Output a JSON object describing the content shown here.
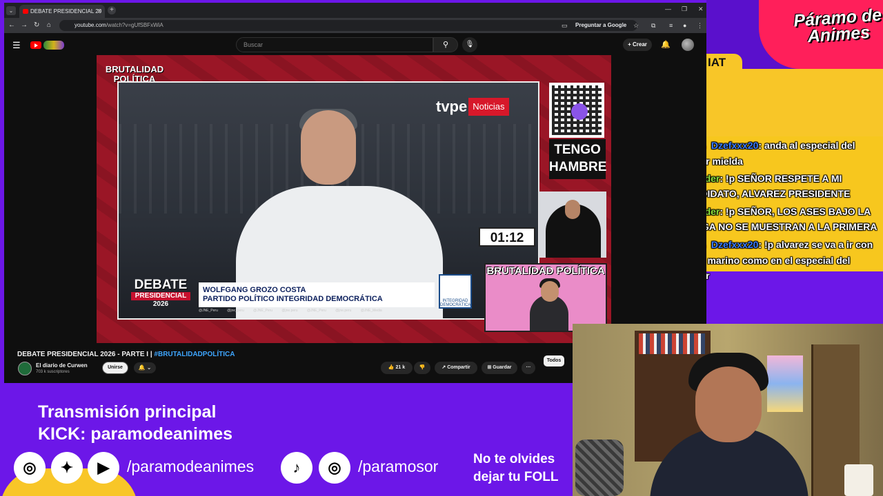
{
  "browser": {
    "tab_title": "DEBATE PRESIDENCIAL 20",
    "url_host": "youtube.com",
    "url_path": "/watch?v=gUfSBFxWiA",
    "ask_google": "Preguntar a Google"
  },
  "youtube": {
    "search_placeholder": "Buscar",
    "create_label": "Crear",
    "video_title": "DEBATE PRESIDENCIAL 2026 - PARTE I |",
    "video_hashtag": "#BRUTALIDADPOLÍTICA",
    "channel_name": "El diario de Curwen",
    "channel_subs": "703 k suscriptores",
    "join_label": "Unirse",
    "likes": "21 k",
    "share_label": "Compartir",
    "save_label": "Guardar",
    "more_label": "···",
    "chip_all": "Todos"
  },
  "video": {
    "brand_logo": "BRUTALIDAD POLÍTICA",
    "tvpe_brand": "tvpe",
    "tvpe_news": "Noticias",
    "debate_word": "DEBATE",
    "debate_sub": "PRESIDENCIAL",
    "debate_year": "2026",
    "speaker_name": "WOLFGANG GROZO COSTA",
    "speaker_party": "PARTIDO POLÍTICO INTEGRIDAD DEMOCRÁTICA",
    "hashtags": "@JNE_Peru @jne_peru @JNE_Peru @jne.peru @JNE_Peru @jne.peru @JNE_Media",
    "party_logo_text": "INTEGRIDAD DEMOCRÁTICA",
    "hambre_text": "TENGO HAMBRE",
    "timer": "01:12",
    "cam_title": "BRUTALIDAD POLÍTICA"
  },
  "overlay": {
    "logo_text": "Páramo de Animes",
    "chat_tab": "IAT",
    "main_stream": "Transmisión principal",
    "kick": "KICK: paramodeanimes",
    "handle_1": "/paramodeanimes",
    "handle_2": "/paramosor",
    "follow_line1": "No te olvides",
    "follow_line2": "dejar tu FOLL"
  },
  "chat": [
    {
      "user": "Dzefxxx20",
      "text": ": anda al especial del humor mielda",
      "color": "blue"
    },
    {
      "user": "Kiriryder",
      "text": ": !p SEÑOR RESPETE A MI CANDIDATO, ALVAREZ PRESIDENTE",
      "color": "green"
    },
    {
      "user": "Kiriryder",
      "text": ": !p SEÑOR, LOS ASES BAJO LA MANGA NO SE MUESTRAN A LA PRIMERA",
      "color": "green"
    },
    {
      "user": "Dzefxxx20",
      "text": ": !p alvarez se va a ir con cindy marino como en el especial del humor",
      "color": "blue"
    }
  ],
  "colors": {
    "overlay_purple": "#6c17e8",
    "accent_yellow": "#f8c628",
    "logo_pink": "#ff1f5a",
    "youtube_red": "#ff0000"
  },
  "icons": [
    "menu-icon",
    "search-icon",
    "mic-icon",
    "bell-icon",
    "like-icon",
    "dislike-icon",
    "share-icon",
    "save-icon",
    "instagram-icon",
    "twitter-icon",
    "youtube-icon",
    "tiktok-icon"
  ]
}
